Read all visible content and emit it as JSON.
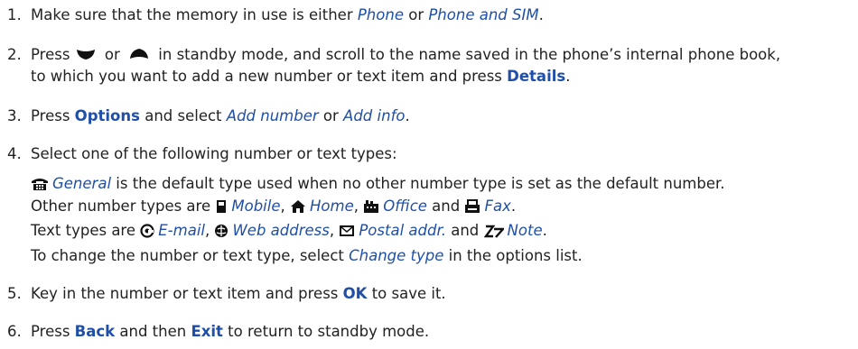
{
  "steps": [
    {
      "num": "1.",
      "t1": "Make sure that the memory in use is either ",
      "e1": "Phone",
      "t2": " or ",
      "e2": "Phone and SIM",
      "t3": "."
    },
    {
      "num": "2.",
      "t1": "Press ",
      "t2": " or ",
      "t3": " in standby mode, and scroll to the name saved in the phone’s internal phone book,",
      "line2a": "to which you want to add a new number or text item and press ",
      "b1": "Details",
      "line2b": "."
    },
    {
      "num": "3.",
      "t1": "Press ",
      "b1": "Options",
      "t2": " and select ",
      "e1": "Add number",
      "t3": " or ",
      "e2": "Add info",
      "t4": "."
    },
    {
      "num": "4.",
      "t1": "Select one of the following number or text types:"
    },
    {
      "num": "5.",
      "t1": "Key in the number or text item and press ",
      "b1": "OK",
      "t2": " to save it."
    },
    {
      "num": "6.",
      "t1": "Press ",
      "b1": "Back",
      "t2": " and then ",
      "b2": "Exit",
      "t3": " to return to standby mode."
    }
  ],
  "types": {
    "general": "General",
    "general_desc": " is the default type used when no other number type is set as the default number.",
    "other_prefix": "Other number types are ",
    "mobile": "Mobile",
    "home": "Home",
    "office": "Office",
    "and": " and ",
    "fax": "Fax",
    "comma": ", ",
    "period": ".",
    "text_prefix": "Text types are ",
    "email": "E-mail",
    "web": "Web address",
    "postal": "Postal addr.",
    "note": "Note",
    "change_prefix": "To change the number or text type, select ",
    "change_type": "Change type",
    "change_suffix": " in the options list."
  },
  "icons": [
    "scroll-down-icon",
    "scroll-up-icon",
    "general-phone-icon",
    "mobile-icon",
    "home-icon",
    "office-icon",
    "fax-icon",
    "email-icon",
    "web-address-icon",
    "postal-address-icon",
    "note-icon"
  ]
}
